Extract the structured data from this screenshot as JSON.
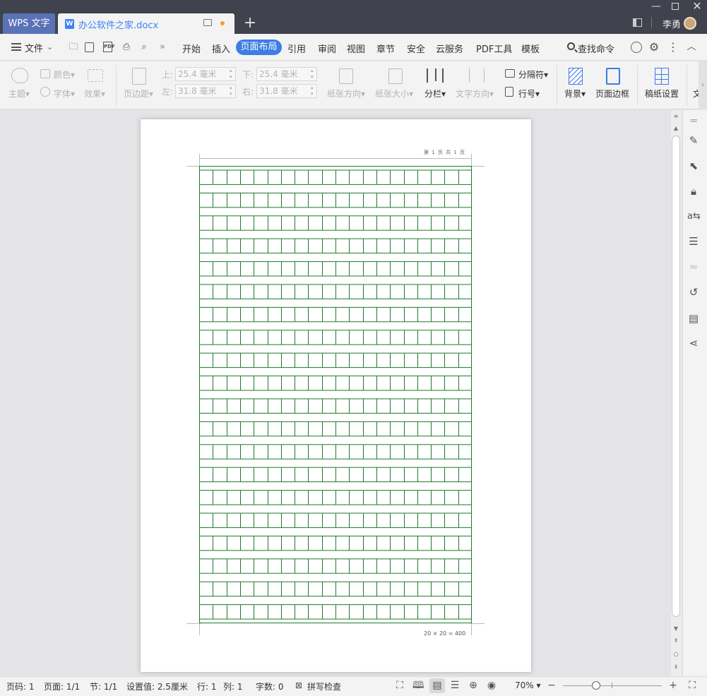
{
  "titlebar": {
    "app_tab": "WPS 文字",
    "doc_tab": "办公软件之家.docx",
    "user_name": "李勇"
  },
  "menubar": {
    "file": "文件",
    "tabs": [
      "开始",
      "插入",
      "页面布局",
      "引用",
      "审阅",
      "视图",
      "章节",
      "安全",
      "云服务",
      "PDF工具",
      "模板"
    ],
    "active_tab": "页面布局",
    "search": "查找命令"
  },
  "ribbon": {
    "theme": "主题",
    "color": "颜色",
    "font": "字体",
    "effect": "效果",
    "margins": "页边距",
    "top_label": "上:",
    "top_value": "25.4 毫米",
    "bottom_label": "下:",
    "bottom_value": "25.4 毫米",
    "left_label": "左:",
    "left_value": "31.8 毫米",
    "right_label": "右:",
    "right_value": "31.8 毫米",
    "orientation": "纸张方向",
    "size": "纸张大小",
    "columns": "分栏",
    "text_direction": "文字方向",
    "breaks": "分隔符",
    "line_numbers": "行号",
    "background": "背景",
    "page_border": "页面边框",
    "manuscript": "稿纸设置",
    "more_partial": "文"
  },
  "document": {
    "header_text": "第 1 页 共 1 页",
    "footer_count": "20 × 20 = 400",
    "grid_rows": 20,
    "grid_cols": 20,
    "grid_color": "#1f7a2a"
  },
  "statusbar": {
    "page_no": "页码: 1",
    "pages": "页面: 1/1",
    "section": "节: 1/1",
    "setting": "设置值: 2.5厘米",
    "row": "行: 1",
    "col": "列: 1",
    "word_count": "字数: 0",
    "spell_check": "拼写检查",
    "zoom": "70%",
    "zoom_fraction": 0.3
  },
  "colors": {
    "accent": "#3d7de4",
    "titlebar_bg": "#40434d",
    "app_tab_bg": "#5a73b8"
  }
}
